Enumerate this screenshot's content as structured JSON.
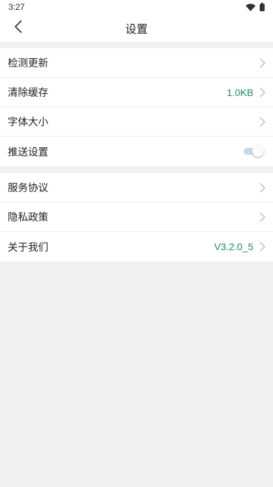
{
  "status_bar": {
    "time": "3:27",
    "icons": [
      "wifi-icon",
      "battery-icon"
    ]
  },
  "header": {
    "title": "设置",
    "back_icon": "chevron-left-icon"
  },
  "groups": [
    {
      "items": [
        {
          "label": "检测更新",
          "value": "",
          "control": "chevron"
        },
        {
          "label": "清除缓存",
          "value": "1.0KB",
          "control": "chevron"
        },
        {
          "label": "字体大小",
          "value": "",
          "control": "chevron"
        },
        {
          "label": "推送设置",
          "value": "",
          "control": "toggle",
          "toggle_on": true
        }
      ]
    },
    {
      "items": [
        {
          "label": "服务协议",
          "value": "",
          "control": "chevron"
        },
        {
          "label": "隐私政策",
          "value": "",
          "control": "chevron"
        },
        {
          "label": "关于我们",
          "value": "V3.2.0_5",
          "control": "chevron"
        }
      ]
    }
  ],
  "colors": {
    "value_text": "#1f8a5c",
    "toggle_track": "#c5d9ec",
    "background": "#f0f0f0"
  }
}
